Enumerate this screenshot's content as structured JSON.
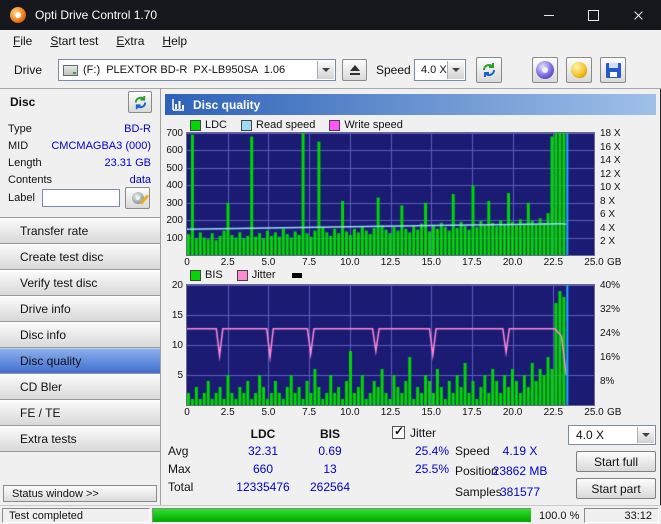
{
  "titlebar": {
    "title": "Opti Drive Control 1.70"
  },
  "menu": [
    "File",
    "Start test",
    "Extra",
    "Help"
  ],
  "toolbar": {
    "drive_label": "Drive",
    "drive_value": "(F:)  PLEXTOR BD-R  PX-LB950SA  1.06",
    "speed_label": "Speed",
    "speed_value": "4.0 X"
  },
  "sidebar": {
    "header": "Disc",
    "fields": [
      {
        "label": "Type",
        "value": "BD-R"
      },
      {
        "label": "MID",
        "value": "CMCMAGBA3 (000)"
      },
      {
        "label": "Length",
        "value": "23.31 GB"
      },
      {
        "label": "Contents",
        "value": "data"
      }
    ],
    "label_field": {
      "label": "Label",
      "value": ""
    },
    "nav": [
      {
        "label": "Transfer rate"
      },
      {
        "label": "Create test disc"
      },
      {
        "label": "Verify test disc"
      },
      {
        "label": "Drive info"
      },
      {
        "label": "Disc info"
      },
      {
        "label": "Disc quality",
        "active": true
      },
      {
        "label": "CD Bler"
      },
      {
        "label": "FE / TE"
      },
      {
        "label": "Extra tests"
      }
    ],
    "status_window": "Status window >>"
  },
  "panel": {
    "title": "Disc quality"
  },
  "chart_data": [
    {
      "type": "bar",
      "title": "LDC errors with read/write speed",
      "legend": [
        {
          "label": "LDC",
          "color": "#00d800"
        },
        {
          "label": "Read speed",
          "color": "#9adcf8"
        },
        {
          "label": "Write speed",
          "color": "#ff55ff"
        }
      ],
      "x_ticks": [
        "0",
        "2.5",
        "5.0",
        "7.5",
        "10.0",
        "12.5",
        "15.0",
        "17.5",
        "20.0",
        "22.5",
        "25.0"
      ],
      "x_unit": "GB",
      "x_max": 25,
      "data_end_gb": 23.3,
      "y_left": {
        "max": 700,
        "ticks": [
          700,
          600,
          500,
          400,
          300,
          200,
          100
        ]
      },
      "y_right": {
        "max": 18,
        "ticks": [
          "18 X",
          "16 X",
          "14 X",
          "12 X",
          "10 X",
          "8 X",
          "6 X",
          "4 X",
          "2 X"
        ]
      },
      "bars": [
        120,
        690,
        95,
        130,
        100,
        90,
        125,
        85,
        110,
        140,
        300,
        115,
        100,
        130,
        95,
        110,
        680,
        105,
        125,
        95,
        140,
        110,
        130,
        105,
        150,
        120,
        100,
        135,
        115,
        700,
        125,
        105,
        140,
        650,
        155,
        130,
        110,
        150,
        125,
        310,
        135,
        115,
        150,
        130,
        165,
        140,
        120,
        155,
        330,
        170,
        145,
        125,
        160,
        140,
        285,
        150,
        130,
        165,
        145,
        180,
        300,
        135,
        170,
        150,
        185,
        160,
        140,
        350,
        155,
        190,
        165,
        145,
        400,
        160,
        195,
        170,
        310,
        185,
        165,
        200,
        175,
        355,
        190,
        170,
        205,
        180,
        300,
        195,
        175,
        210,
        185,
        240,
        680,
        700,
        700,
        700
      ],
      "lines": [
        {
          "name": "read-speed",
          "color": "#9adcf8",
          "y_max": 700,
          "points": [
            [
              0,
              148
            ],
            [
              5,
              155
            ],
            [
              10,
              162
            ],
            [
              15,
              169
            ],
            [
              20,
              175
            ],
            [
              23.0,
              180
            ],
            [
              23.3,
              176
            ]
          ]
        }
      ],
      "end_line_color": "#22aaff"
    },
    {
      "type": "bar",
      "title": "BIS errors with jitter",
      "legend": [
        {
          "label": "BIS",
          "color": "#00d800"
        },
        {
          "label": "Jitter",
          "color": "#ff8ad8"
        }
      ],
      "x_ticks": [
        "0",
        "2.5",
        "5.0",
        "7.5",
        "10.0",
        "12.5",
        "15.0",
        "17.5",
        "20.0",
        "22.5",
        "25.0"
      ],
      "x_unit": "GB",
      "x_max": 25,
      "data_end_gb": 23.3,
      "y_left": {
        "max": 20,
        "ticks": [
          20,
          15,
          10,
          5
        ]
      },
      "y_right": {
        "max": 40,
        "ticks": [
          "40%",
          "32%",
          "24%",
          "16%",
          "8%"
        ]
      },
      "bars": [
        2,
        1,
        3,
        1,
        2,
        4,
        1,
        2,
        3,
        1,
        5,
        2,
        1,
        3,
        2,
        4,
        1,
        2,
        5,
        3,
        1,
        2,
        4,
        2,
        1,
        3,
        5,
        2,
        3,
        1,
        4,
        2,
        6,
        3,
        1,
        2,
        5,
        2,
        3,
        1,
        4,
        9,
        2,
        3,
        5,
        1,
        2,
        4,
        3,
        6,
        2,
        1,
        5,
        3,
        2,
        4,
        8,
        1,
        3,
        2,
        5,
        4,
        2,
        6,
        3,
        1,
        4,
        2,
        5,
        3,
        7,
        2,
        4,
        1,
        3,
        5,
        2,
        6,
        4,
        2,
        5,
        3,
        6,
        4,
        2,
        5,
        3,
        7,
        4,
        6,
        5,
        8,
        6,
        17,
        19,
        18
      ],
      "lines": [
        {
          "name": "jitter",
          "color": "#ff8ad8",
          "y_max": 20,
          "points": [
            [
              0,
              12.7
            ],
            [
              1.8,
              12.7
            ],
            [
              2.0,
              8.2
            ],
            [
              2.2,
              12.7
            ],
            [
              4.9,
              12.7
            ],
            [
              5.1,
              8.0
            ],
            [
              5.3,
              12.7
            ],
            [
              7.4,
              12.7
            ],
            [
              7.6,
              8.5
            ],
            [
              7.8,
              12.7
            ],
            [
              11.4,
              12.7
            ],
            [
              11.6,
              9.0
            ],
            [
              11.8,
              12.7
            ],
            [
              14.9,
              12.7
            ],
            [
              15.1,
              8.3
            ],
            [
              15.3,
              12.7
            ],
            [
              19.4,
              12.7
            ],
            [
              19.6,
              8.8
            ],
            [
              19.8,
              12.7
            ],
            [
              22.6,
              12.7
            ],
            [
              23.0,
              11.5
            ],
            [
              23.3,
              5.0
            ]
          ]
        }
      ],
      "end_line_color": "#22aaff"
    }
  ],
  "stats": {
    "columns": [
      "LDC",
      "BIS"
    ],
    "rows": [
      {
        "label": "Avg",
        "ldc": "32.31",
        "bis": "0.69",
        "jitter": "25.4%"
      },
      {
        "label": "Max",
        "ldc": "660",
        "bis": "13",
        "jitter": "25.5%"
      },
      {
        "label": "Total",
        "ldc": "12335476",
        "bis": "262564",
        "jitter": ""
      }
    ],
    "jitter_label": "Jitter",
    "jitter_checked": true,
    "speed_label": "Speed",
    "speed_value": "4.19 X",
    "position_label": "Position",
    "position_value": "23862 MB",
    "samples_label": "Samples",
    "samples_value": "381577",
    "speed_select": "4.0 X",
    "start_full": "Start full",
    "start_part": "Start part"
  },
  "statusbar": {
    "text": "Test completed",
    "percent": "100.0 %",
    "progress": 100,
    "time": "33:12"
  }
}
